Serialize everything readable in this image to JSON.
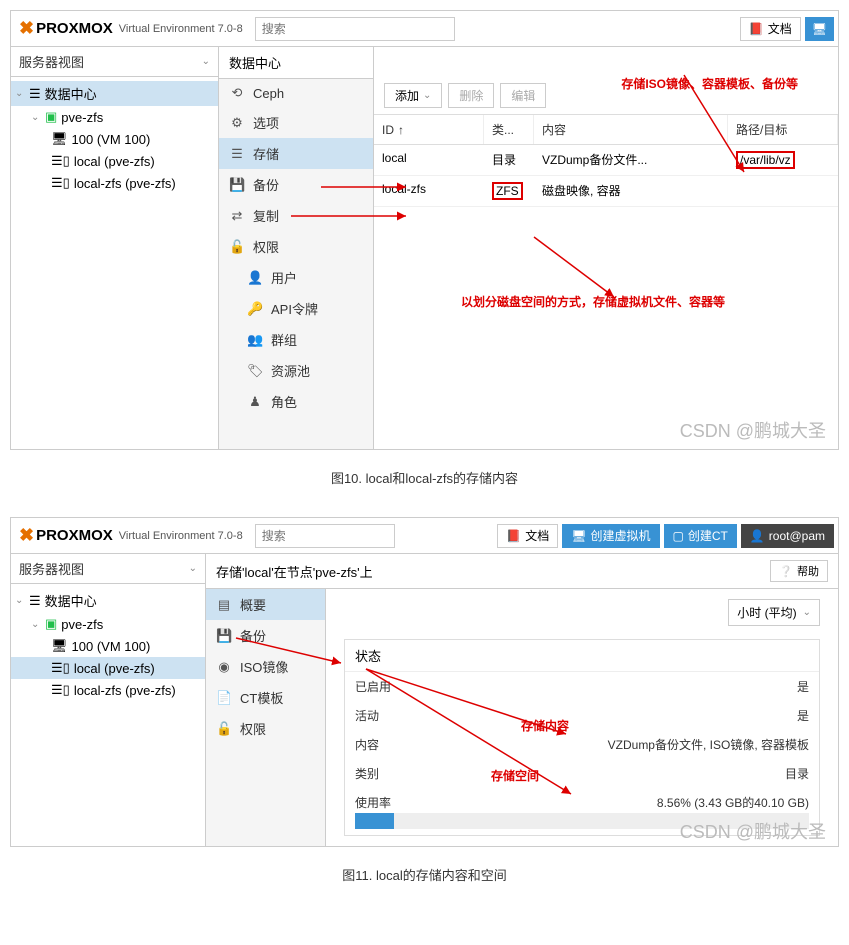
{
  "fig10": {
    "brand": "PROXMOX",
    "version": "Virtual Environment 7.0-8",
    "search_placeholder": "搜索",
    "doc_btn": "文档",
    "view_selector": "服务器视图",
    "tree": {
      "datacenter": "数据中心",
      "node": "pve-zfs",
      "vm": "100 (VM 100)",
      "storage1": "local (pve-zfs)",
      "storage2": "local-zfs (pve-zfs)"
    },
    "mid_title": "数据中心",
    "mid_items": {
      "ceph": "Ceph",
      "options": "选项",
      "storage": "存储",
      "backup": "备份",
      "replication": "复制",
      "permissions": "权限",
      "users": "用户",
      "api_tokens": "API令牌",
      "groups": "群组",
      "pools": "资源池",
      "roles": "角色"
    },
    "toolbar": {
      "add": "添加",
      "remove": "删除",
      "edit": "编辑"
    },
    "grid_headers": {
      "id": "ID",
      "type": "类...",
      "content": "内容",
      "path": "路径/目标"
    },
    "rows": [
      {
        "id": "local",
        "type": "目录",
        "content": "VZDump备份文件...",
        "path": "/var/lib/vz"
      },
      {
        "id": "local-zfs",
        "type": "ZFS",
        "content": "磁盘映像, 容器",
        "path": ""
      }
    ],
    "annot_top": "存储ISO镜像、容器模板、备份等",
    "annot_mid": "以划分磁盘空间的方式，存储虚拟机文件、容器等",
    "watermark": "CSDN @鹏城大圣",
    "caption": "图10. local和local-zfs的存储内容"
  },
  "fig11": {
    "brand": "PROXMOX",
    "version": "Virtual Environment 7.0-8",
    "search_placeholder": "搜索",
    "doc_btn": "文档",
    "create_vm": "创建虚拟机",
    "create_ct": "创建CT",
    "user_btn": "root@pam",
    "view_selector": "服务器视图",
    "tree": {
      "datacenter": "数据中心",
      "node": "pve-zfs",
      "vm": "100 (VM 100)",
      "storage1": "local (pve-zfs)",
      "storage2": "local-zfs (pve-zfs)"
    },
    "breadcrumb": "存储'local'在节点'pve-zfs'上",
    "help": "帮助",
    "mid_items": {
      "summary": "概要",
      "backup": "备份",
      "iso": "ISO镜像",
      "ct_templates": "CT模板",
      "permissions": "权限"
    },
    "time_range": "小时 (平均)",
    "status_title": "状态",
    "kv": {
      "enabled_k": "已启用",
      "enabled_v": "是",
      "active_k": "活动",
      "active_v": "是",
      "content_k": "内容",
      "content_v": "VZDump备份文件, ISO镜像, 容器模板",
      "type_k": "类别",
      "type_v": "目录",
      "usage_k": "使用率",
      "usage_v": "8.56% (3.43 GB的40.10 GB)"
    },
    "annot_content": "存储内容",
    "annot_space": "存储空间",
    "watermark": "CSDN @鹏城大圣",
    "caption": "图11. local的存储内容和空间"
  }
}
